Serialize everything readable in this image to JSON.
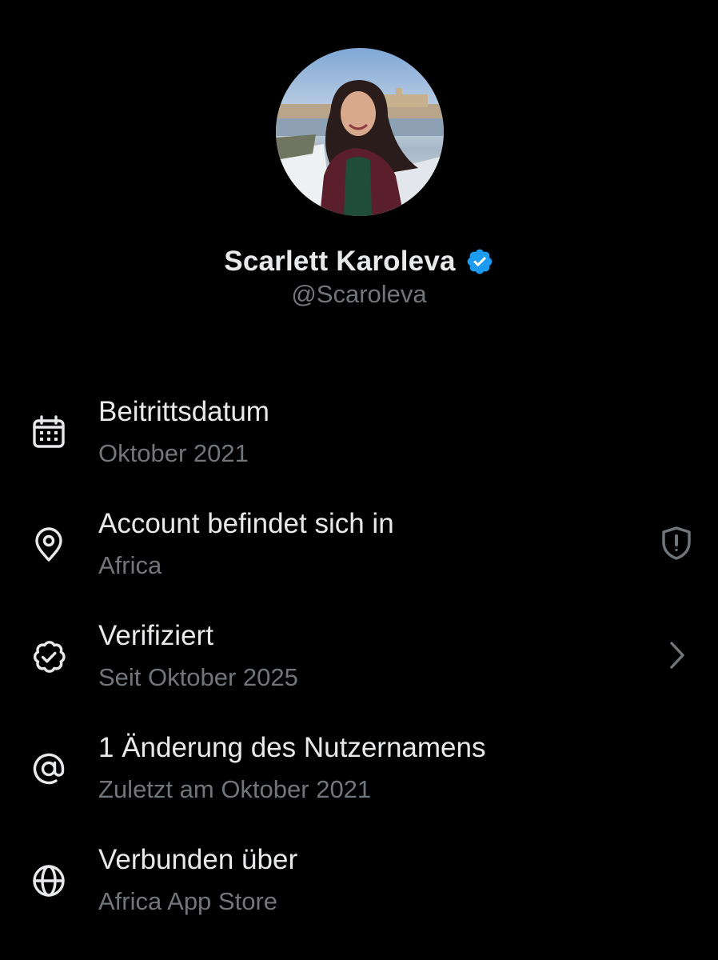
{
  "profile": {
    "display_name": "Scarlett Karoleva",
    "handle": "@Scaroleva",
    "verified_badge_color": "#1d9bf0",
    "avatar_icon": "avatar-photo"
  },
  "info": [
    {
      "icon": "calendar-icon",
      "title": "Beitrittsdatum",
      "subtitle": "Oktober 2021"
    },
    {
      "icon": "location-pin-icon",
      "title": "Account befindet sich in",
      "subtitle": "Africa",
      "right_icon": "shield-alert-icon"
    },
    {
      "icon": "verified-badge-outline-icon",
      "title": "Verifiziert",
      "subtitle": "Seit Oktober 2025",
      "right_icon": "chevron-right-icon"
    },
    {
      "icon": "at-sign-icon",
      "title": "1 Änderung des Nutzernamens",
      "subtitle": "Zuletzt am Oktober 2021"
    },
    {
      "icon": "globe-icon",
      "title": "Verbunden über",
      "subtitle": "Africa App Store"
    }
  ],
  "colors": {
    "background": "#000000",
    "primary_text": "#e7e9ea",
    "secondary_text": "#71767b",
    "accent": "#1d9bf0"
  }
}
